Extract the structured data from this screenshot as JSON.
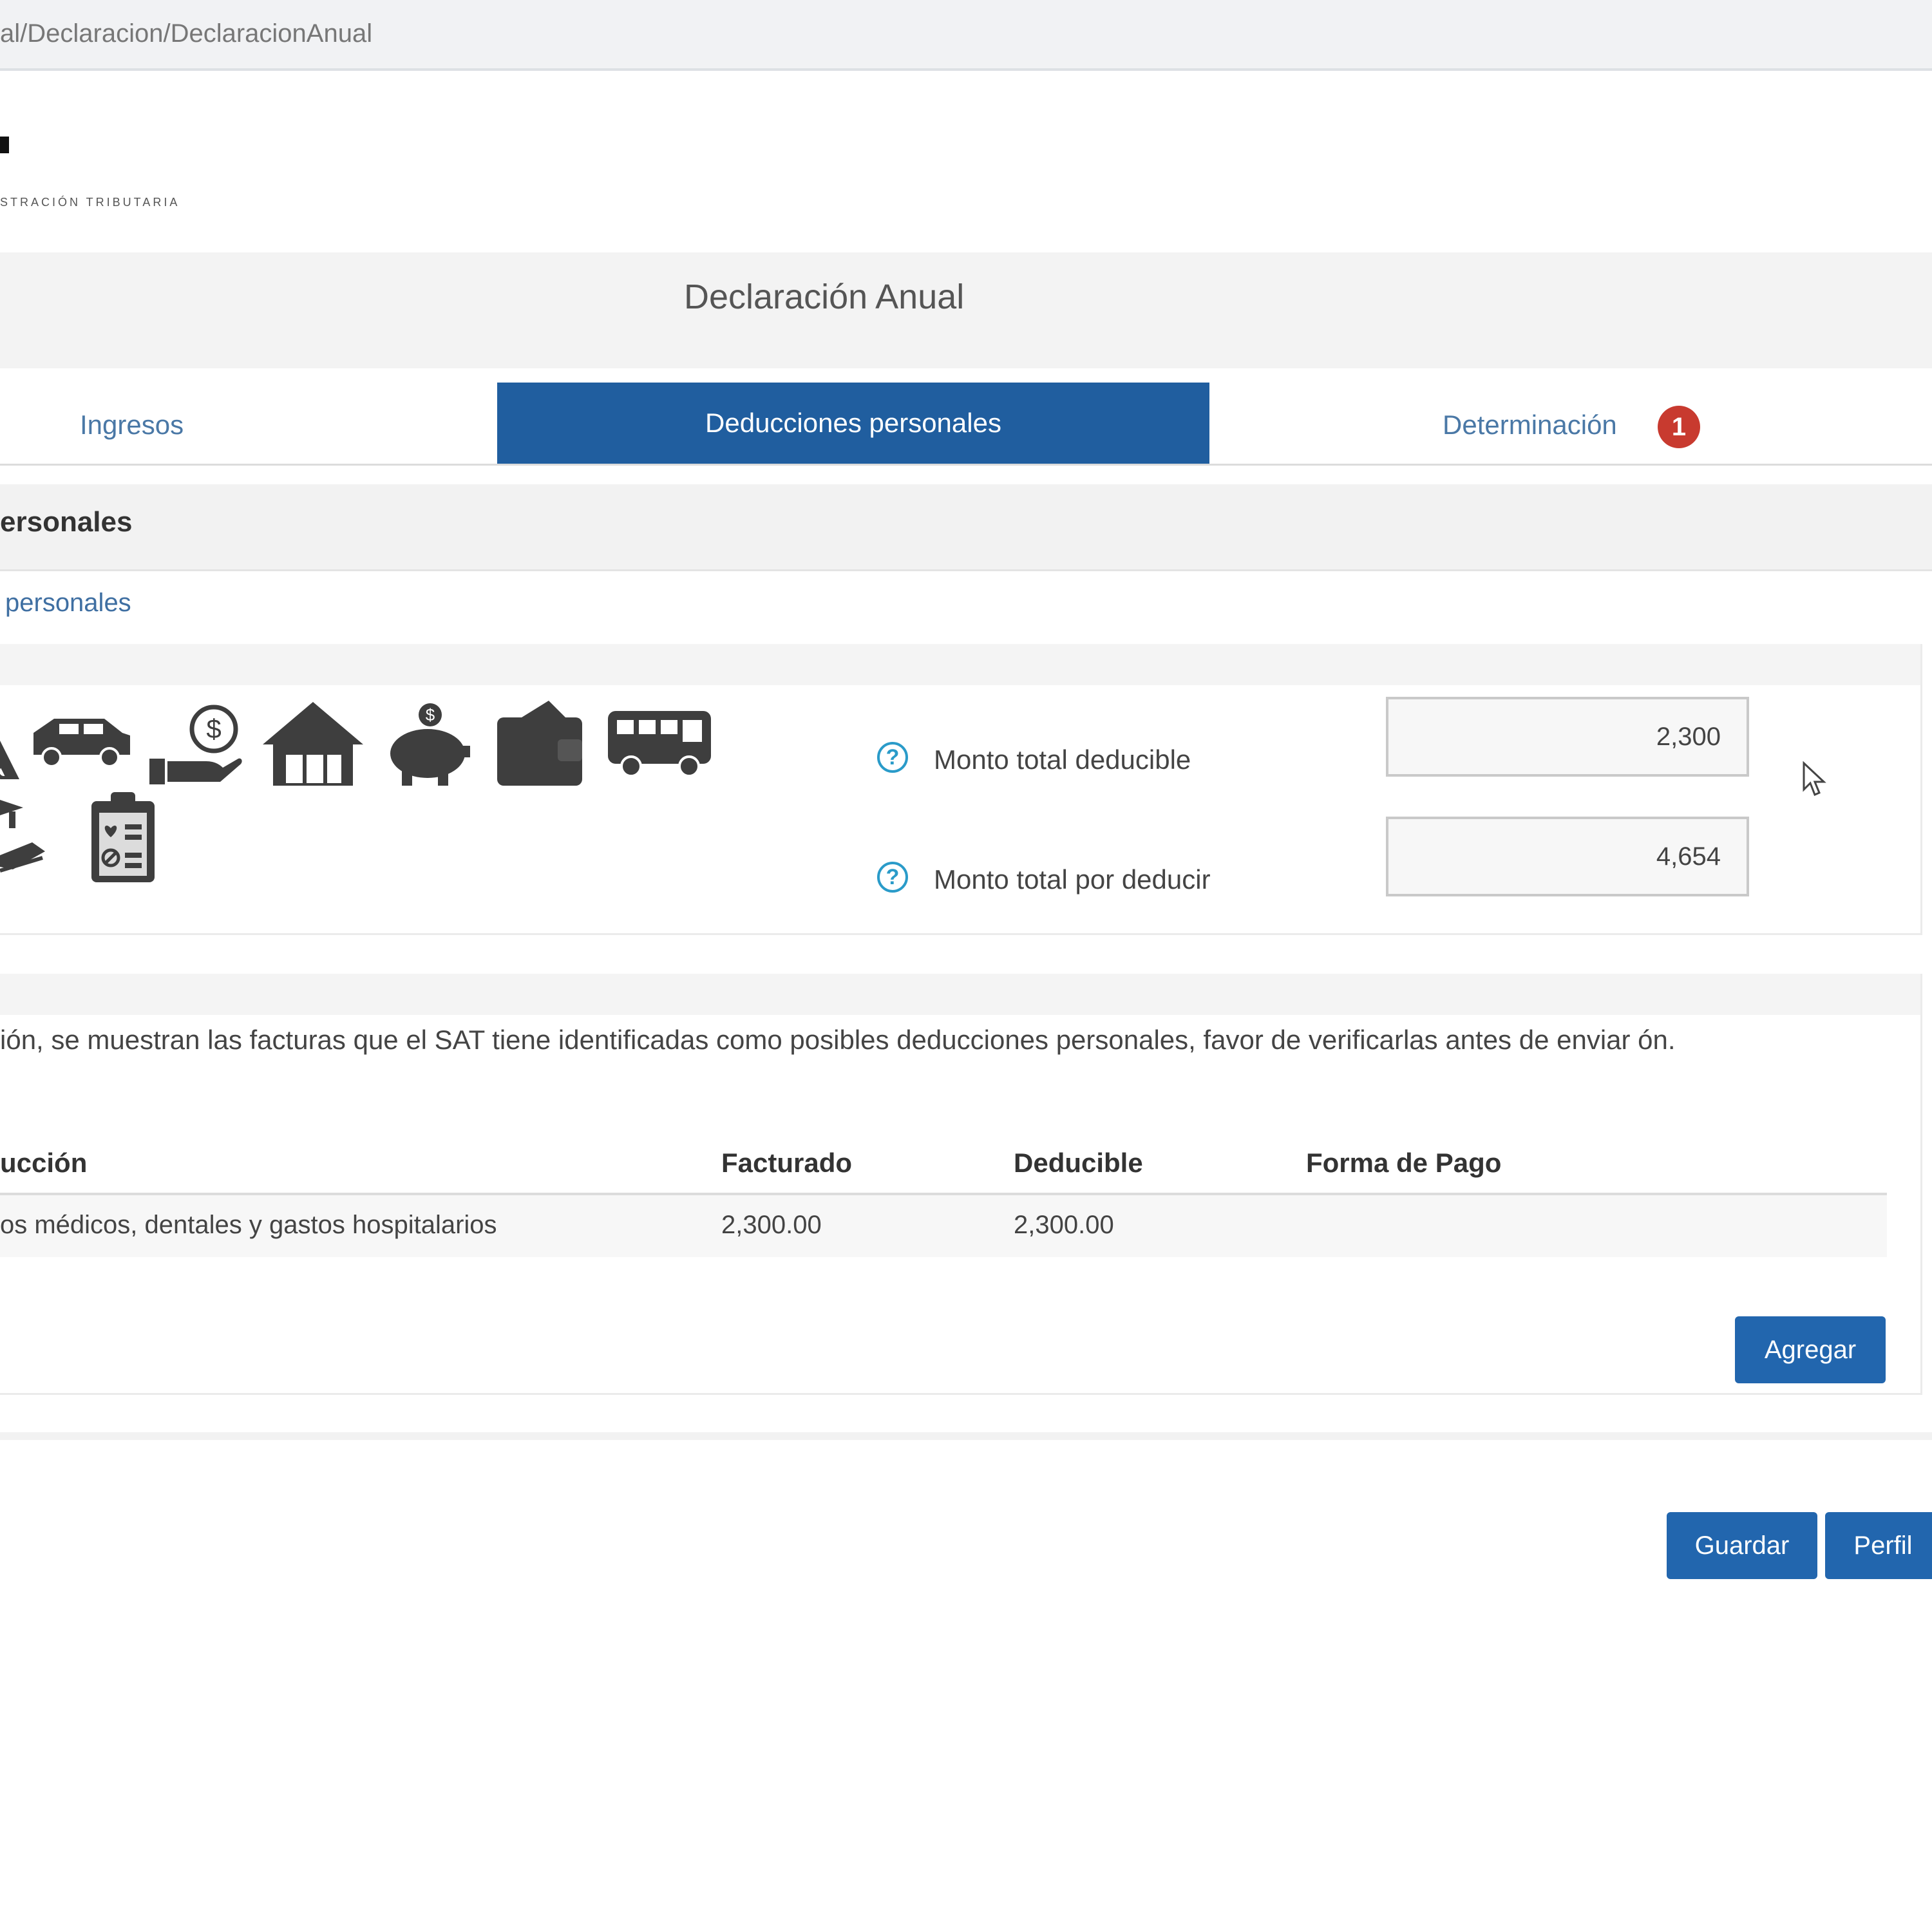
{
  "browser": {
    "url": "al/Declaracion/DeclaracionAnual"
  },
  "logo": {
    "subtitle": "STRACIÓN TRIBUTARIA"
  },
  "page": {
    "title": "Declaración Anual"
  },
  "tabs": [
    {
      "label": "Ingresos",
      "active": false
    },
    {
      "label": "Deducciones personales",
      "active": true
    },
    {
      "label": "Determinación",
      "active": false,
      "badge": "1"
    }
  ],
  "section": {
    "title": "ersonales",
    "link": "personales"
  },
  "categories": {
    "icons": [
      "glasses-icon",
      "car-icon",
      "money-hand-icon",
      "house-icon",
      "piggy-bank-icon",
      "wallet-icon",
      "bus-icon",
      "graduation-icon",
      "medical-report-icon"
    ]
  },
  "totals": {
    "deducible_label": "Monto total deducible",
    "deducible_value": "2,300",
    "por_deducir_label": "Monto total por deducir",
    "por_deducir_value": "4,654"
  },
  "invoices": {
    "info_text": "ión, se muestran las facturas que el SAT tiene identificadas como posibles deducciones personales, favor de verificarlas antes de enviar ón.",
    "columns": [
      "ucción",
      "Facturado",
      "Deducible",
      "Forma de Pago"
    ],
    "rows": [
      [
        "os médicos, dentales y gastos hospitalarios",
        "2,300.00",
        "2,300.00",
        ""
      ]
    ],
    "add_label": "Agregar"
  },
  "actions": {
    "save_label": "Guardar",
    "profile_label": "Perfil"
  },
  "colors": {
    "primary": "#205e9f",
    "link": "#4a78a6",
    "badge": "#c83a2f",
    "help": "#2a9bc9",
    "icons": "#3e3e3e"
  }
}
